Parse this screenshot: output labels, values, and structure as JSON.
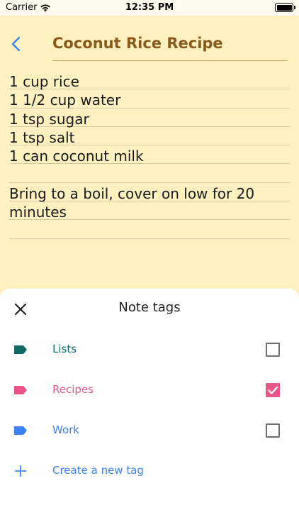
{
  "status_bar": {
    "carrier": "Carrier",
    "time": "12:35 PM"
  },
  "note": {
    "title": "Coconut Rice Recipe",
    "lines": [
      "1 cup rice",
      "1 1/2 cup water",
      "1 tsp sugar",
      "1 tsp salt",
      "1 can coconut milk",
      "",
      "Bring to a boil, cover on low for 20",
      "minutes",
      ""
    ]
  },
  "sheet": {
    "title": "Note tags",
    "tags": [
      {
        "label": "Lists",
        "color": "#0f6b66",
        "checked": false
      },
      {
        "label": "Recipes",
        "color": "#e8558a",
        "checked": true
      },
      {
        "label": "Work",
        "color": "#3b82f6",
        "checked": false
      }
    ],
    "create_label": "Create a new tag",
    "create_color": "#3b82f6"
  },
  "colors": {
    "accent": "#3b82f6",
    "title": "#8a5a1c",
    "note_bg": "#fef1bf"
  }
}
